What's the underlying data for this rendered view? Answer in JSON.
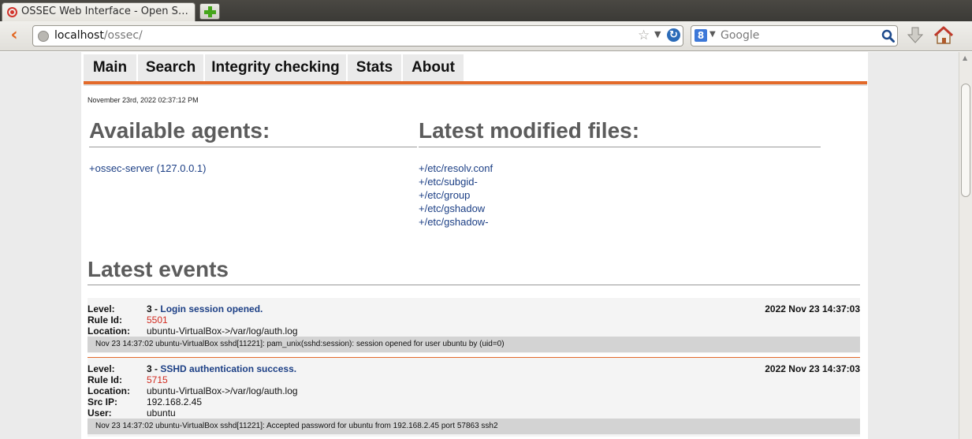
{
  "browser": {
    "tab_title": "OSSEC Web Interface - Open S…",
    "url_host": "localhost",
    "url_path": "/ossec/",
    "search_engine_letter": "8",
    "search_placeholder": "Google"
  },
  "menu": {
    "items": [
      {
        "label": "Main"
      },
      {
        "label": "Search"
      },
      {
        "label": "Integrity checking"
      },
      {
        "label": "Stats"
      },
      {
        "label": "About"
      }
    ]
  },
  "date": "November 23rd, 2022 02:37:12 PM",
  "agents": {
    "heading": "Available agents:",
    "items": [
      "+ossec-server (127.0.0.1)"
    ]
  },
  "files": {
    "heading": "Latest modified files:",
    "items": [
      "+/etc/resolv.conf",
      "+/etc/subgid-",
      "+/etc/group",
      "+/etc/gshadow",
      "+/etc/gshadow-"
    ]
  },
  "events": {
    "heading": "Latest events",
    "labels": {
      "level": "Level:",
      "rule_id": "Rule Id:",
      "location": "Location:",
      "src_ip": "Src IP:",
      "user": "User:"
    },
    "items": [
      {
        "level": "3",
        "separator": " - ",
        "description": "Login session opened.",
        "date": "2022 Nov 23 14:37:03",
        "rule_id": "5501",
        "location": "ubuntu-VirtualBox->/var/log/auth.log",
        "log": "Nov 23 14:37:02 ubuntu-VirtualBox sshd[11221]: pam_unix(sshd:session): session opened for user ubuntu by (uid=0)"
      },
      {
        "level": "3",
        "separator": " - ",
        "description": "SSHD authentication success.",
        "date": "2022 Nov 23 14:37:03",
        "rule_id": "5715",
        "location": "ubuntu-VirtualBox->/var/log/auth.log",
        "src_ip": "192.168.2.45",
        "user": "ubuntu",
        "log": "Nov 23 14:37:02 ubuntu-VirtualBox sshd[11221]: Accepted password for ubuntu from 192.168.2.45 port 57863 ssh2"
      }
    ]
  },
  "colors": {
    "accent_rule": "#e36a2a",
    "link": "#1c3f85",
    "rule_id": "#d12a1f",
    "heading": "#5c5c5c"
  }
}
